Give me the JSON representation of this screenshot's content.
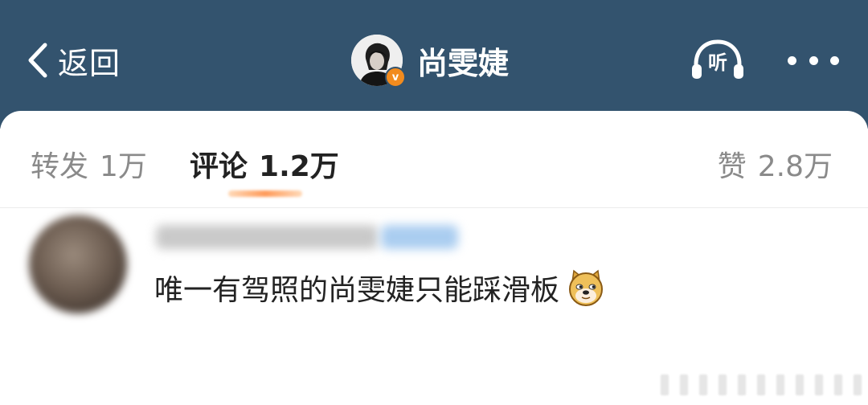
{
  "nav": {
    "back_label": "返回",
    "title": "尚雯婕",
    "verified_mark": "v",
    "listen_label": "听",
    "icons": {
      "back": "chevron-left-icon",
      "listen": "headphones-icon",
      "more": "more-dots-icon",
      "verified": "verified-badge-icon"
    }
  },
  "tabs": {
    "repost": {
      "label": "转发",
      "count": "1万"
    },
    "comment": {
      "label": "评论",
      "count": "1.2万",
      "active": true
    },
    "like": {
      "label": "赞",
      "count": "2.8万"
    }
  },
  "comment": {
    "text": "唯一有驾照的尚雯婕只能踩滑板",
    "emoji": "doge-emoji"
  },
  "colors": {
    "header_bg": "#33536e",
    "active_tab_text": "#222222",
    "inactive_tab_text": "#8a8a8a",
    "tab_indicator": "#ff9b5a",
    "verified_badge": "#f28b1e"
  }
}
